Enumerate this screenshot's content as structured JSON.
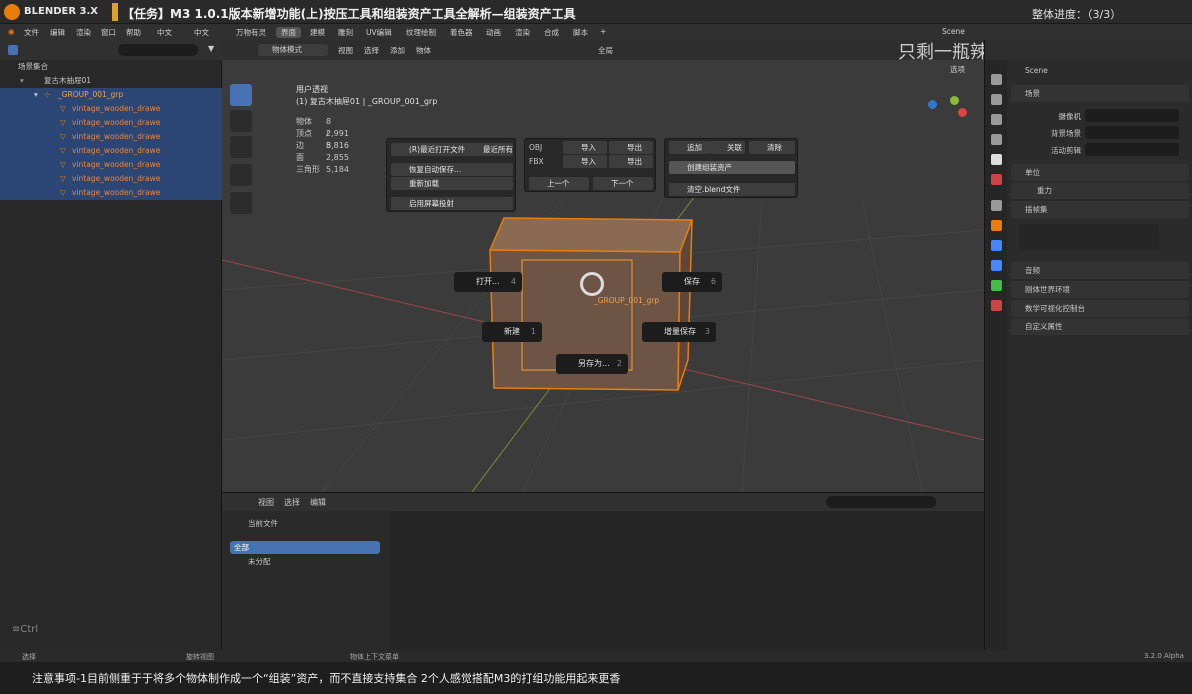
{
  "banner": {
    "app": "BLENDER 3.X",
    "title": "【任务】M3 1.0.1版本新增功能(上)按压工具和组装资产工具全解析—组装资产工具",
    "progress": "整体进度：（3/3）"
  },
  "menu": [
    "文件",
    "编辑",
    "渲染",
    "窗口",
    "帮助",
    "中文",
    "中文"
  ],
  "workspaces": [
    "万物有灵",
    "界面",
    "建模",
    "雕刻",
    "UV编辑",
    "纹理绘制",
    "着色器",
    "动画",
    "渲染",
    "合成",
    "脚本"
  ],
  "scene": "Scene",
  "watermark": "只剩一瓶辣椒酱",
  "outliner": {
    "root": "场景集合",
    "collection": "复古木抽屉01",
    "group": "_GROUP_001_grp",
    "child": "vintage_wooden_drawe"
  },
  "viewport": {
    "mode": "物体模式",
    "menu": [
      "视图",
      "选择",
      "添加",
      "物体"
    ],
    "global": "全局",
    "options": "选项",
    "persp": "用户透视",
    "name": "(1) 复古木抽屉01 | _GROUP_001_grp",
    "obj_label": "_GROUP_001_grp"
  },
  "stats": [
    [
      "物体",
      "8 / 8"
    ],
    [
      "顶点",
      "2,991"
    ],
    [
      "边",
      "5,816"
    ],
    [
      "面",
      "2,855"
    ],
    [
      "三角形",
      "5,184"
    ]
  ],
  "panel": {
    "recent": "(R)最近打开文件",
    "recent_all": "最近所有",
    "recover": "恢复自动保存...",
    "reload": "重新加载",
    "cast": "启用屏幕投射",
    "obj": "OBJ",
    "fbx": "FBX",
    "imp": "导入",
    "exp": "导出",
    "prev": "上一个",
    "next": "下一个",
    "append": "追加",
    "link": "关联",
    "clear": "清除",
    "create": "创建组装资产",
    "empty": "清空.blend文件"
  },
  "pie": {
    "open": "打开...",
    "open_n": "4",
    "save": "保存",
    "save_n": "6",
    "new": "新建",
    "new_n": "1",
    "inc": "增量保存",
    "inc_n": "3",
    "saveas": "另存为...",
    "saveas_n": "2"
  },
  "asset": {
    "menu": [
      "视图",
      "选择",
      "编辑"
    ],
    "library": "当前文件",
    "all": "全部",
    "unassigned": "未分配"
  },
  "props": {
    "scene": "Scene",
    "sec_scene": "场景",
    "camera": "摄像机",
    "bg": "背景场景",
    "clip": "活动剪辑",
    "units": "单位",
    "gravity": "重力",
    "keying": "插帧集",
    "audio": "音频",
    "rigid": "刚体世界环境",
    "dataviz": "数学可视化控制台",
    "custom": "自定义属性"
  },
  "ctrl": "≡Ctrl",
  "status": {
    "select": "选择",
    "rotate": "旋转视图",
    "context": "物体上下文菜单",
    "version": "3.2.0 Alpha"
  },
  "subtitle": "注意事项-1目前侧重于于将多个物体制作成一个“组装”资产，而不直接支持集合 2个人感觉搭配M3的打组功能用起来更香"
}
